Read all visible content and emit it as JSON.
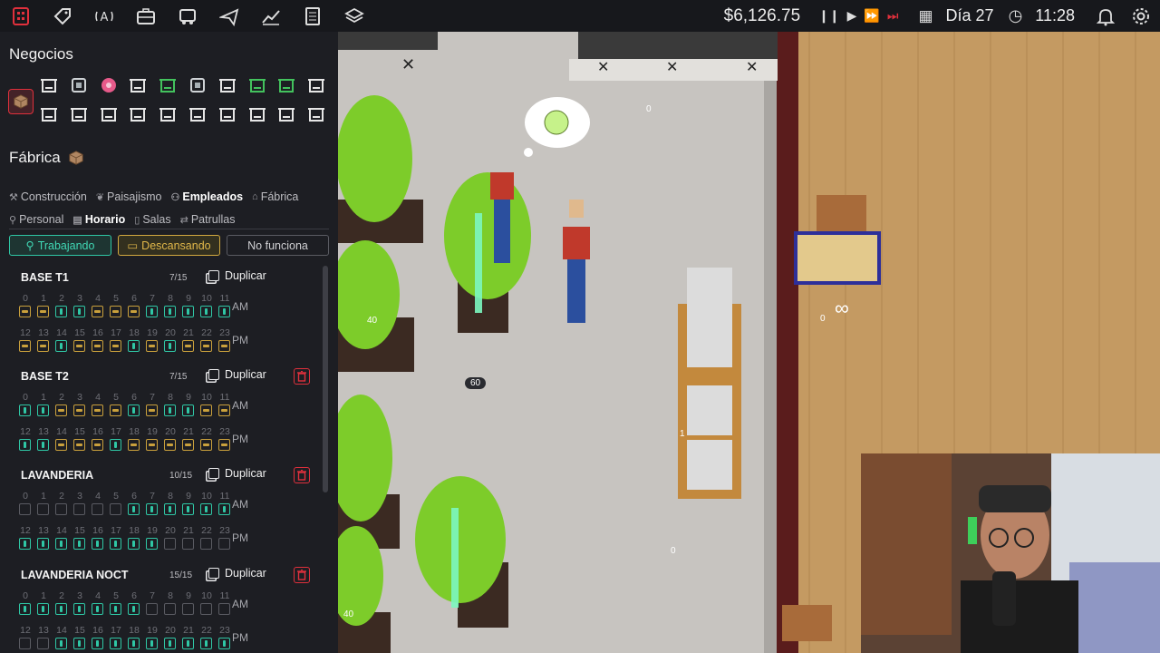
{
  "topbar": {
    "icons": [
      "sector-icon",
      "tag-icon",
      "radio-icon",
      "briefcase-icon",
      "truck-icon",
      "plane-icon",
      "chart-icon",
      "document-icon",
      "layers-icon"
    ],
    "money": "$6,126.75",
    "day": "Día 27",
    "time": "11:28"
  },
  "sidebar": {
    "negocios_title": "Negocios",
    "fabrica_title": "Fábrica",
    "tabs_main": [
      {
        "label": "Construcción",
        "active": false
      },
      {
        "label": "Paisajismo",
        "active": false
      },
      {
        "label": "Empleados",
        "active": true
      },
      {
        "label": "Fábrica",
        "active": false
      }
    ],
    "tabs_sub": [
      {
        "label": "Personal",
        "active": false
      },
      {
        "label": "Horario",
        "active": true
      },
      {
        "label": "Salas",
        "active": false
      },
      {
        "label": "Patrullas",
        "active": false
      }
    ],
    "status": {
      "working": "Trabajando",
      "resting": "Descansando",
      "off": "No funciona"
    },
    "duplicate_label": "Duplicar",
    "am_label": "AM",
    "pm_label": "PM",
    "hours_am": [
      "0",
      "1",
      "2",
      "3",
      "4",
      "5",
      "6",
      "7",
      "8",
      "9",
      "10",
      "11"
    ],
    "hours_pm": [
      "12",
      "13",
      "14",
      "15",
      "16",
      "17",
      "18",
      "19",
      "20",
      "21",
      "22",
      "23"
    ],
    "schedules": [
      {
        "name": "BASE T1",
        "count": "7/15",
        "deletable": false,
        "am": "rrwwrrrwwwww",
        "pm": "rrwrrrwrwrrr"
      },
      {
        "name": "BASE T2",
        "count": "7/15",
        "deletable": true,
        "am": "wwrrrrwrwwrr",
        "pm": "wwrrrwrrrrrr"
      },
      {
        "name": "LAVANDERIA",
        "count": "10/15",
        "deletable": true,
        "am": "------wwwwww",
        "pm": "wwwwwwww----"
      },
      {
        "name": "LAVANDERIA NOCT",
        "count": "15/15",
        "deletable": true,
        "am": "wwwwwww-----",
        "pm": "--wwwwwwwwww"
      }
    ]
  },
  "game": {
    "labels": {
      "plant_1": "40",
      "plant_2": "40",
      "light_score": "60",
      "store_1": "0",
      "store_2": "1",
      "store_3": "0",
      "table": "0"
    }
  }
}
